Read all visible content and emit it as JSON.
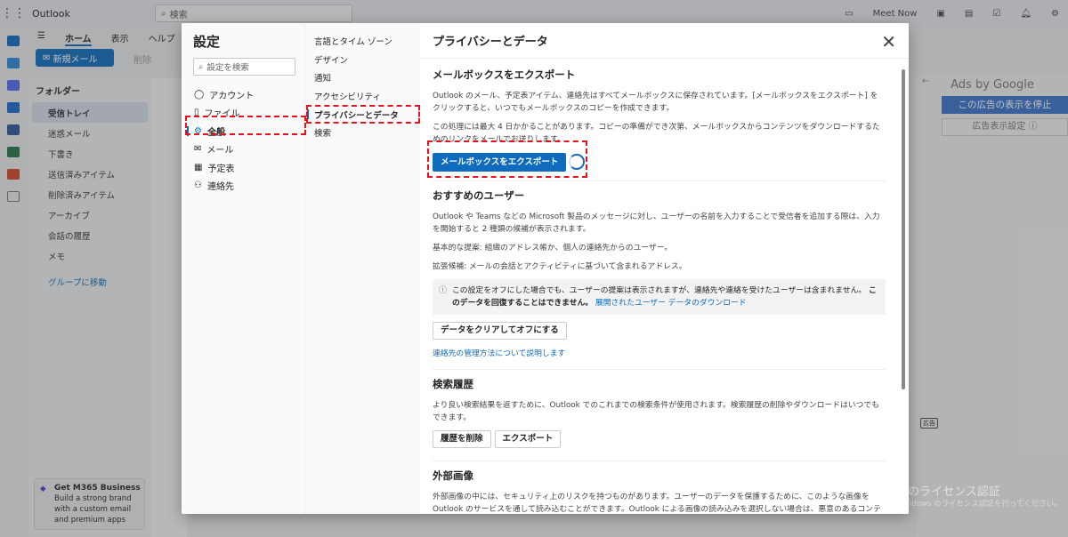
{
  "topbar": {
    "app_name": "Outlook",
    "search_placeholder": "検索",
    "meet_now": "Meet Now"
  },
  "ribbon": {
    "tabs": [
      "ホーム",
      "表示",
      "ヘルプ"
    ],
    "new_mail": "新規メール",
    "delete": "削除"
  },
  "folders": {
    "header": "フォルダー",
    "items": [
      "受信トレイ",
      "迷惑メール",
      "下書き",
      "送信済みアイテム",
      "削除済みアイテム",
      "アーカイブ",
      "会話の履歴",
      "メモ"
    ],
    "groups": "グループに移動"
  },
  "promo": {
    "title": "Get M365 Business",
    "text": "Build a strong brand with a custom email and premium apps"
  },
  "ads": {
    "title": "Ads by Google",
    "stop": "この広告の表示を停止",
    "settings": "広告表示設定 ⓘ",
    "label": "広告"
  },
  "watermark": {
    "title": "Windows のライセンス認証",
    "text": "設定を開き、Windows のライセンス認証を行ってください。"
  },
  "settings": {
    "title": "設定",
    "search_placeholder": "設定を検索",
    "nav": [
      {
        "label": "アカウント",
        "icon": "person-icon"
      },
      {
        "label": "ファイル",
        "icon": "file-icon"
      },
      {
        "label": "全般",
        "icon": "gear-icon"
      },
      {
        "label": "メール",
        "icon": "mail-icon"
      },
      {
        "label": "予定表",
        "icon": "calendar-icon"
      },
      {
        "label": "連絡先",
        "icon": "people-icon"
      }
    ],
    "subnav": [
      "言語とタイム ゾーン",
      "デザイン",
      "通知",
      "アクセシビリティ",
      "プライバシーとデータ",
      "検索"
    ],
    "page_title": "プライバシーとデータ",
    "export": {
      "heading": "メールボックスをエクスポート",
      "p1": "Outlook のメール、予定表アイテム、連絡先はすべてメールボックスに保存されています。[メールボックスをエクスポート] をクリックすると、いつでもメールボックスのコピーを作成できます。",
      "p2": "この処理には最大 4 日かかることがあります。コピーの準備ができ次第、メールボックスからコンテンツをダウンロードするためのリンクをメールでお送りします。",
      "button": "メールボックスをエクスポート"
    },
    "suggested": {
      "heading": "おすすめのユーザー",
      "p1": "Outlook や Teams などの Microsoft 製品のメッセージに対し、ユーザーの名前を入力することで受信者を追加する際は、入力を開始すると 2 種類の候補が表示されます。",
      "p2": "基本的な提案: 組織のアドレス帳か、個人の連絡先からのユーザー。",
      "p3": "拡張候補: メールの会話とアクティビティに基づいて含まれるアドレス。",
      "info": "この設定をオフにした場合でも、ユーザーの提案は表示されますが、連絡先や連絡を受けたユーザーは含まれません。",
      "info_bold": "このデータを回復することはできません。",
      "info_link": "展開されたユーザー データのダウンロード",
      "clear_button": "データをクリアしてオフにする",
      "learn_link": "連絡先の管理方法について説明します"
    },
    "history": {
      "heading": "検索履歴",
      "p": "より良い検索結果を返すために、Outlook でのこれまでの検索条件が使用されます。検索履歴の削除やダウンロードはいつでもできます。",
      "delete": "履歴を削除",
      "export": "エクスポート"
    },
    "images": {
      "heading": "外部画像",
      "p": "外部画像の中には、セキュリティ上のリスクを持つものがあります。ユーザーのデータを保護するために、このような画像を Outlook のサービスを通して読み込むことができます。Outlook による画像の読み込みを選択しない場合は、悪意のあるコンテ"
    }
  }
}
